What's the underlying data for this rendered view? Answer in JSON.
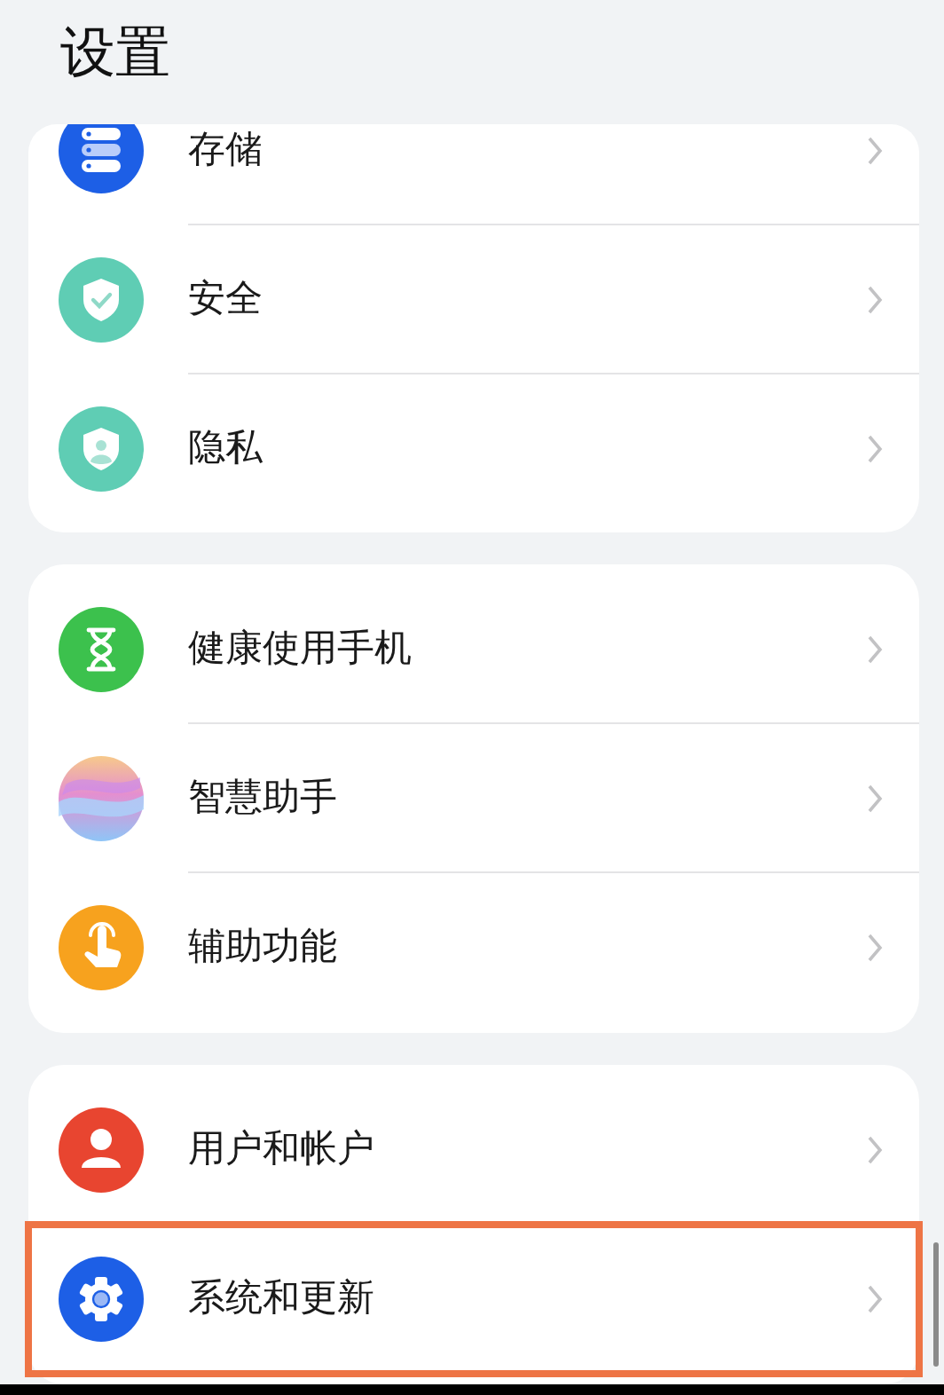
{
  "title": "设置",
  "groups": [
    {
      "items": [
        {
          "label": "存储",
          "kind": "storage",
          "highlighted": false
        },
        {
          "label": "安全",
          "kind": "security",
          "highlighted": false
        },
        {
          "label": "隐私",
          "kind": "privacy",
          "highlighted": false
        }
      ]
    },
    {
      "items": [
        {
          "label": "健康使用手机",
          "kind": "hourglass",
          "highlighted": false
        },
        {
          "label": "智慧助手",
          "kind": "assistant",
          "highlighted": false
        },
        {
          "label": "辅助功能",
          "kind": "accessibility",
          "highlighted": false
        }
      ]
    },
    {
      "items": [
        {
          "label": "用户和帐户",
          "kind": "user",
          "highlighted": false
        },
        {
          "label": "系统和更新",
          "kind": "gear",
          "highlighted": true
        }
      ]
    }
  ]
}
